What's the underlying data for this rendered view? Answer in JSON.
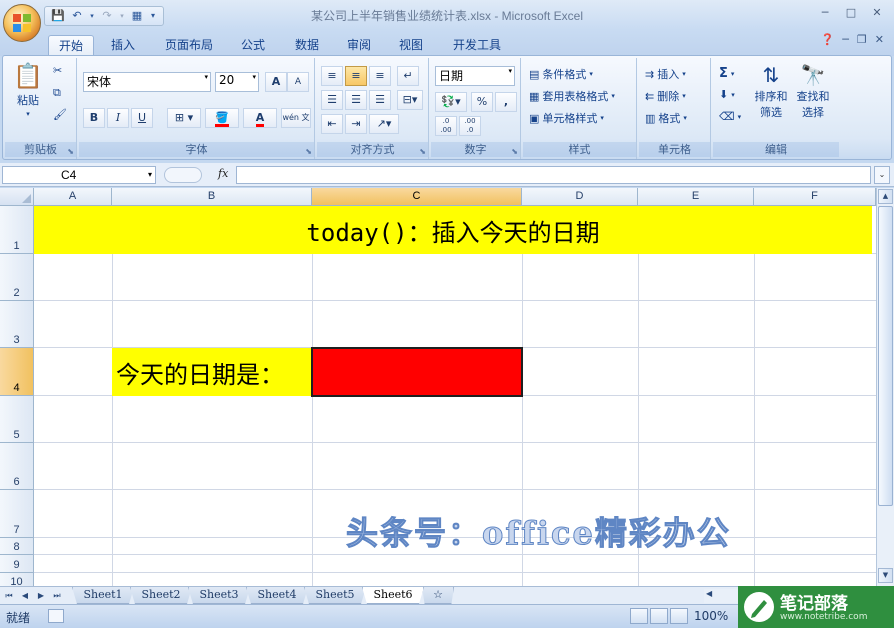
{
  "window": {
    "title": "某公司上半年销售业绩统计表.xlsx - Microsoft Excel",
    "controls": [
      "─",
      "□",
      "✕"
    ]
  },
  "ribbon_tabs": [
    "开始",
    "插入",
    "页面布局",
    "公式",
    "数据",
    "审阅",
    "视图",
    "开发工具"
  ],
  "ribbon": {
    "clipboard": {
      "paste": "粘贴",
      "label": "剪贴板"
    },
    "font": {
      "name": "宋体",
      "size": "20",
      "grow": "A",
      "shrink": "A",
      "bold": "B",
      "italic": "I",
      "underline": "U",
      "color_a": "A",
      "phonetic": "wén 文",
      "label": "字体"
    },
    "alignment": {
      "label": "对齐方式"
    },
    "number": {
      "format": "日期",
      "percent": "%",
      "comma": ",",
      "inc_decimal": ".0 .00",
      "dec_decimal": ".00 .0",
      "label": "数字"
    },
    "styles": {
      "conditional": "条件格式",
      "table_format": "套用表格格式",
      "cell_styles": "单元格样式",
      "label": "样式"
    },
    "cells": {
      "insert": "插入",
      "delete": "删除",
      "format": "格式",
      "label": "单元格"
    },
    "editing": {
      "sigma": "Σ",
      "sort_filter": "排序和\n筛选",
      "sort_line1": "排序和",
      "sort_line2": "筛选",
      "find_line1": "查找和",
      "find_line2": "选择",
      "label": "编辑"
    }
  },
  "formula_bar": {
    "name_box": "C4",
    "fx": "fx",
    "content": ""
  },
  "grid": {
    "columns": [
      "A",
      "B",
      "C",
      "D",
      "E",
      "F"
    ],
    "rows": [
      "1",
      "2",
      "3",
      "4",
      "5",
      "6",
      "7",
      "8",
      "9",
      "10"
    ],
    "selected_col": "C",
    "selected_row": "4",
    "banner": "today()：插入今天的日期",
    "label": "今天的日期是：",
    "active_value": ""
  },
  "colors": {
    "yellow": "#ffff00",
    "red": "#ff0000",
    "brand_green": "#2f8f3f"
  },
  "watermark": "头条号：office精彩办公",
  "sheet_tabs": [
    "Sheet1",
    "Sheet2",
    "Sheet3",
    "Sheet4",
    "Sheet5",
    "Sheet6"
  ],
  "active_sheet": "Sheet6",
  "status": {
    "ready": "就绪",
    "zoom": "100%"
  },
  "brand": {
    "name": "笔记部落",
    "url": "www.notetribe.com"
  }
}
